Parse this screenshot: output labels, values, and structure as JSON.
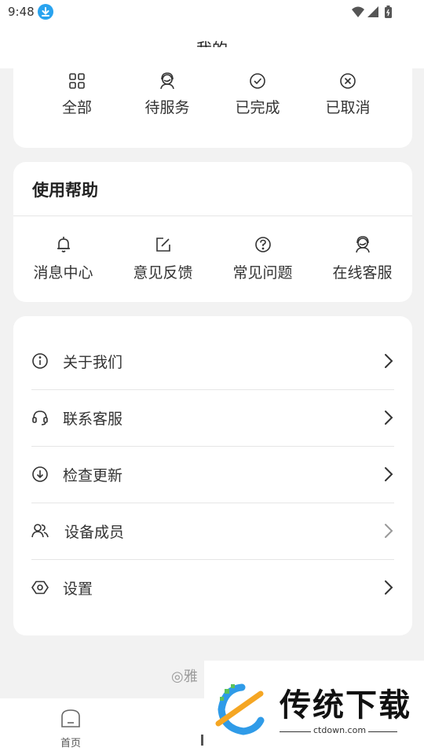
{
  "status_bar": {
    "time": "9:48",
    "icons": [
      "download-badge-icon",
      "wifi-icon",
      "signal-icon",
      "battery-icon"
    ]
  },
  "header": {
    "title": "我的"
  },
  "orders": {
    "items": [
      {
        "label": "全部",
        "icon": "grid-icon"
      },
      {
        "label": "待服务",
        "icon": "service-agent-icon"
      },
      {
        "label": "已完成",
        "icon": "check-circle-icon"
      },
      {
        "label": "已取消",
        "icon": "x-circle-icon"
      }
    ]
  },
  "help": {
    "title": "使用帮助",
    "items": [
      {
        "label": "消息中心",
        "icon": "bell-icon"
      },
      {
        "label": "意见反馈",
        "icon": "edit-icon"
      },
      {
        "label": "常见问题",
        "icon": "question-circle-icon"
      },
      {
        "label": "在线客服",
        "icon": "service-agent-icon"
      }
    ]
  },
  "menu": {
    "items": [
      {
        "label": "关于我们",
        "icon": "info-circle-icon"
      },
      {
        "label": "联系客服",
        "icon": "headset-icon"
      },
      {
        "label": "检查更新",
        "icon": "download-circle-icon"
      },
      {
        "label": "设备成员",
        "icon": "users-icon"
      },
      {
        "label": "设置",
        "icon": "hexagon-settings-icon"
      }
    ]
  },
  "footer": {
    "text": "◎雅"
  },
  "tabbar": {
    "home_label": "首页"
  },
  "watermark": {
    "brand": "传统下载",
    "url": "ctdown.com"
  },
  "colors": {
    "background": "#f2f2f2",
    "card": "#ffffff",
    "accent_blue": "#29a3ef",
    "text": "#333333"
  }
}
